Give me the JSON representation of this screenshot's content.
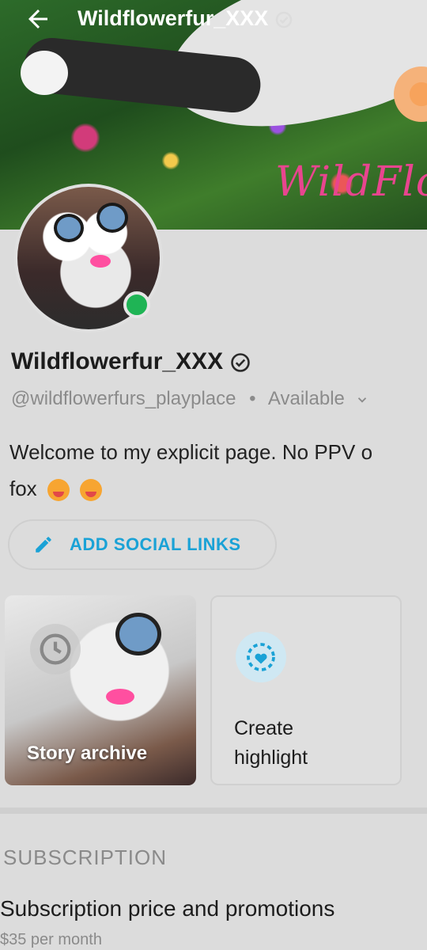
{
  "header": {
    "title": "Wildflowerfur_XXX",
    "back_icon": "arrow-left-icon",
    "banner_text": "WildFlo"
  },
  "profile": {
    "name": "Wildflowerfur_XXX",
    "handle": "@wildflowerfurs_playplace",
    "status": "Available",
    "bio_line1": "Welcome to my explicit page. No PPV o",
    "bio_line2": "fox"
  },
  "social": {
    "label": "ADD SOCIAL LINKS"
  },
  "highlights": {
    "story_label": "Story archive",
    "create_label_1": "Create",
    "create_label_2": "highlight"
  },
  "subscription": {
    "section_title": "SUBSCRIPTION",
    "item_title": "Subscription price and promotions",
    "price": "$35 per month"
  },
  "colors": {
    "accent": "#1aa2d6",
    "online": "#1fb455",
    "brand": "#e8458f"
  }
}
